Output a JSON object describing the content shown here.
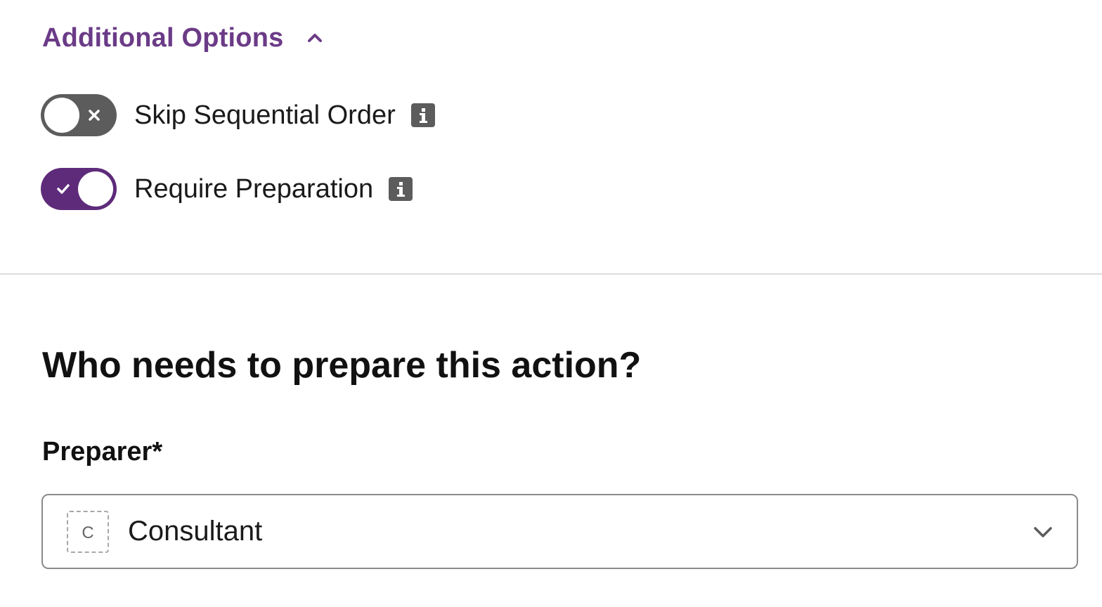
{
  "additional_options": {
    "title": "Additional Options",
    "expanded": true,
    "icon": "chevron-up-icon"
  },
  "options": [
    {
      "label": "Skip Sequential Order",
      "enabled": false,
      "toggle_icon": "x-icon",
      "info_icon": "info-icon"
    },
    {
      "label": "Require Preparation",
      "enabled": true,
      "toggle_icon": "check-icon",
      "info_icon": "info-icon"
    }
  ],
  "preparer_section": {
    "heading": "Who needs to prepare this action?",
    "field_label": "Preparer*",
    "selected": {
      "initial": "C",
      "value": "Consultant"
    },
    "dropdown_icon": "chevron-down-icon"
  },
  "colors": {
    "accent": "#6b3b87",
    "toggle_on": "#5e2b7a",
    "toggle_off": "#5c5c5c",
    "divider": "#dcdcdc",
    "border": "#8a8a8a"
  }
}
